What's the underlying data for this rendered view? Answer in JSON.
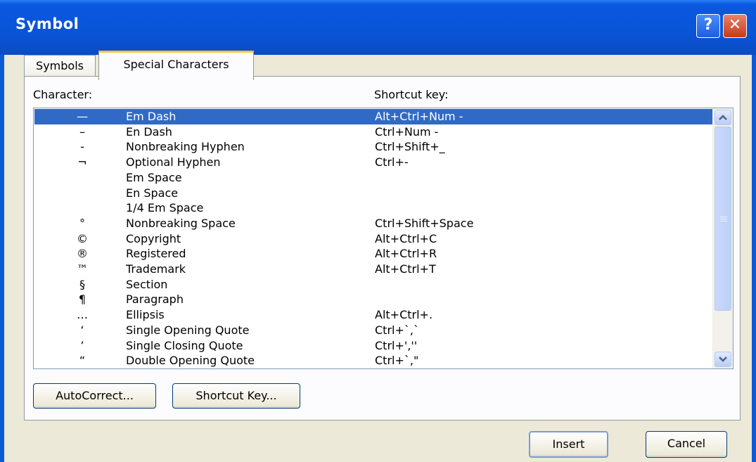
{
  "window": {
    "title": "Symbol",
    "help_label": "?",
    "close_label": "✕"
  },
  "tabs": [
    {
      "label": "Symbols"
    },
    {
      "label": "Special Characters"
    }
  ],
  "columns": {
    "character": "Character:",
    "shortcut": "Shortcut key:"
  },
  "rows": [
    {
      "char": "—",
      "name": "Em Dash",
      "key": "Alt+Ctrl+Num -",
      "selected": true
    },
    {
      "char": "–",
      "name": "En Dash",
      "key": "Ctrl+Num -"
    },
    {
      "char": "-",
      "name": "Nonbreaking Hyphen",
      "key": "Ctrl+Shift+_"
    },
    {
      "char": "¬",
      "name": "Optional Hyphen",
      "key": "Ctrl+-"
    },
    {
      "char": "",
      "name": "Em Space",
      "key": ""
    },
    {
      "char": "",
      "name": "En Space",
      "key": ""
    },
    {
      "char": "",
      "name": "1/4 Em Space",
      "key": ""
    },
    {
      "char": "°",
      "name": "Nonbreaking Space",
      "key": "Ctrl+Shift+Space"
    },
    {
      "char": "©",
      "name": "Copyright",
      "key": "Alt+Ctrl+C"
    },
    {
      "char": "®",
      "name": "Registered",
      "key": "Alt+Ctrl+R"
    },
    {
      "char": "™",
      "name": "Trademark",
      "key": "Alt+Ctrl+T"
    },
    {
      "char": "§",
      "name": "Section",
      "key": ""
    },
    {
      "char": "¶",
      "name": "Paragraph",
      "key": ""
    },
    {
      "char": "…",
      "name": "Ellipsis",
      "key": "Alt+Ctrl+."
    },
    {
      "char": "‘",
      "name": "Single Opening Quote",
      "key": "Ctrl+`,`"
    },
    {
      "char": "’",
      "name": "Single Closing Quote",
      "key": "Ctrl+',''"
    },
    {
      "char": "“",
      "name": "Double Opening Quote",
      "key": "Ctrl+`,\""
    }
  ],
  "buttons": {
    "autocorrect": "AutoCorrect...",
    "shortcut_key": "Shortcut Key...",
    "insert": "Insert",
    "cancel": "Cancel"
  },
  "colors": {
    "title_bar": "#0a54d6",
    "selection": "#316ac5",
    "active_tab_accent": "#ffc83c"
  }
}
